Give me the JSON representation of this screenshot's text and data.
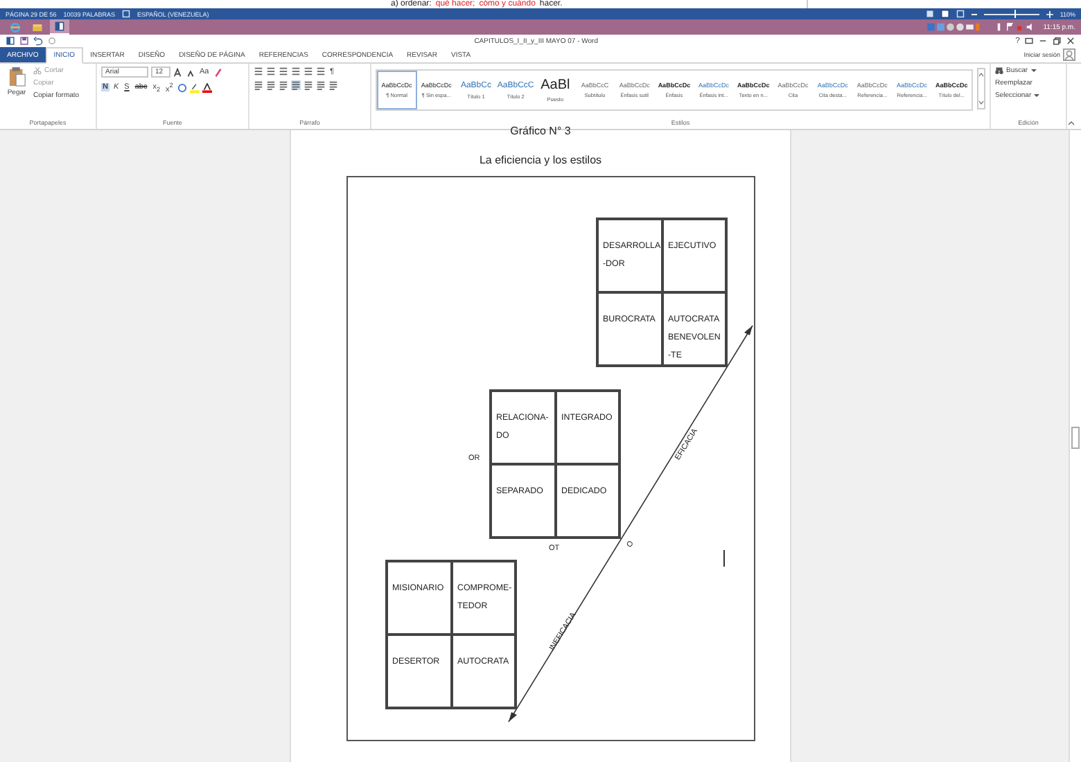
{
  "background_document": {
    "segments": [
      {
        "text": "a) ordenar:",
        "emphasis": false
      },
      {
        "text": "qué hacer;",
        "emphasis": true
      },
      {
        "text": "cómo y cuándo",
        "emphasis": true
      },
      {
        "text": "hacer.",
        "emphasis": false
      }
    ]
  },
  "status_bar": {
    "page": "PÁGINA 29 DE 56",
    "words": "10039 PALABRAS",
    "language": "ESPAÑOL (VENEZUELA)",
    "zoom": "110%",
    "zoom_slider": {
      "level": 0.55
    }
  },
  "taskbar": {
    "apps": [
      {
        "kind": "browser",
        "selected": false
      },
      {
        "kind": "folder",
        "selected": false
      },
      {
        "kind": "word",
        "selected": true
      }
    ],
    "clock": "11:15 p.m."
  },
  "window": {
    "title": "CAPITULOS_I_II_y_III MAYO 07 - Word",
    "help": "?"
  },
  "tabs": [
    {
      "label": "ARCHIVO",
      "kind": "file",
      "selected": false
    },
    {
      "label": "INICIO",
      "kind": "tab",
      "selected": true
    },
    {
      "label": "INSERTAR",
      "kind": "tab",
      "selected": false
    },
    {
      "label": "DISEÑO",
      "kind": "tab",
      "selected": false
    },
    {
      "label": "DISEÑO DE PÁGINA",
      "kind": "tab",
      "selected": false
    },
    {
      "label": "REFERENCIAS",
      "kind": "tab",
      "selected": false
    },
    {
      "label": "CORRESPONDENCIA",
      "kind": "tab",
      "selected": false
    },
    {
      "label": "REVISAR",
      "kind": "tab",
      "selected": false
    },
    {
      "label": "VISTA",
      "kind": "tab",
      "selected": false
    }
  ],
  "sign_in": "Iniciar sesión",
  "ribbon": {
    "clipboard": {
      "paste": "Pegar",
      "cut": "Cortar",
      "copy": "Copiar",
      "format_painter": "Copiar formato",
      "label": "Portapapeles"
    },
    "font": {
      "family": "Arial",
      "size": "12",
      "change_case": "Aa",
      "bold": "N",
      "italic": "K",
      "underline": "S",
      "strikethrough": "abc",
      "subscript": "x$_{2}$",
      "superscript": "x$^{2}$",
      "label": "Fuente"
    },
    "paragraph": {
      "show_marks": "¶",
      "label": "Párrafo"
    },
    "styles": {
      "label": "Estilos",
      "items": [
        {
          "preview": "AaBbCcDc",
          "name": "¶ Normal",
          "kind": "body",
          "selected": true
        },
        {
          "preview": "AaBbCcDc",
          "name": "¶ Sin espa...",
          "kind": "body",
          "selected": false
        },
        {
          "preview": "AaBbCc",
          "name": "Título 1",
          "kind": "heading",
          "selected": false
        },
        {
          "preview": "AaBbCcC",
          "name": "Título 2",
          "kind": "heading",
          "selected": false
        },
        {
          "preview": "AaBl",
          "name": "Puesto",
          "kind": "title",
          "selected": false
        },
        {
          "preview": "AaBbCcC",
          "name": "Subtítulo",
          "kind": "subtle",
          "selected": false
        },
        {
          "preview": "AaBbCcDc",
          "name": "Énfasis sutil",
          "kind": "subtle",
          "selected": false
        },
        {
          "preview": "AaBbCcDc",
          "name": "Énfasis",
          "kind": "strong",
          "selected": false
        },
        {
          "preview": "AaBbCcDc",
          "name": "Énfasis int...",
          "kind": "accent",
          "selected": false
        },
        {
          "preview": "AaBbCcDc",
          "name": "Texto en n...",
          "kind": "strong",
          "selected": false
        },
        {
          "preview": "AaBbCcDc",
          "name": "Cita",
          "kind": "subtle",
          "selected": false
        },
        {
          "preview": "AaBbCcDc",
          "name": "Cita desta...",
          "kind": "accent",
          "selected": false
        },
        {
          "preview": "AaBbCcDc",
          "name": "Referencia...",
          "kind": "subtle",
          "selected": false
        },
        {
          "preview": "AaBbCcDc",
          "name": "Referencia...",
          "kind": "accent",
          "selected": false
        },
        {
          "preview": "AaBbCcDc",
          "name": "Título del...",
          "kind": "strong",
          "selected": false
        }
      ]
    },
    "editing": {
      "find": "Buscar",
      "replace": "Reemplazar",
      "select": "Seleccionar",
      "label": "Edición"
    }
  },
  "document": {
    "heading": "Gráfico N° 3",
    "subheading": "La eficiencia y los estilos",
    "grids": [
      {
        "cells": [
          [
            "DESARROLLA",
            "-DOR"
          ],
          [
            "EJECUTIVO"
          ],
          [
            "BUROCRATA"
          ],
          [
            "AUTOCRATA",
            "BENEVOLEN",
            "-TE"
          ]
        ]
      },
      {
        "cells": [
          [
            "RELACIONA-",
            "DO"
          ],
          [
            "INTEGRADO"
          ],
          [
            "SEPARADO"
          ],
          [
            "DEDICADO"
          ]
        ]
      },
      {
        "cells": [
          [
            "MISIONARIO"
          ],
          [
            "COMPROME-",
            "TEDOR"
          ],
          [
            "DESERTOR"
          ],
          [
            "AUTOCRATA"
          ]
        ]
      }
    ],
    "axis_labels": {
      "or": "OR",
      "ot": "OT",
      "o": "O",
      "efficacy": "EFICACIA",
      "inefficacy": "INEFICACIA"
    }
  }
}
